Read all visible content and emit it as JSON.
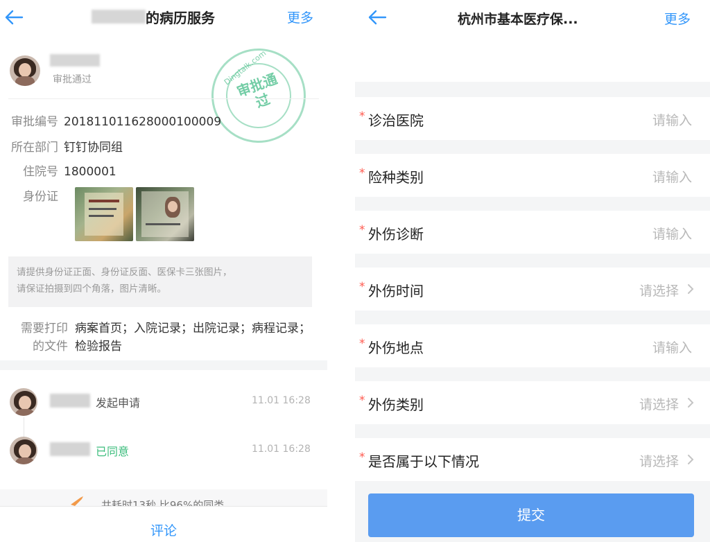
{
  "left": {
    "nav": {
      "title": "的病历服务",
      "more": "更多"
    },
    "applicant": {
      "status": "审批通过"
    },
    "stamp": {
      "site": "Dingtalk.com",
      "text": "审批通过"
    },
    "fields": [
      {
        "key": "审批编号",
        "value": "20181101162800010000 9"
      },
      {
        "key": "所在部门",
        "value": "钉钉协同组"
      },
      {
        "key": "住院号",
        "value": "1800001"
      },
      {
        "key": "身份证",
        "value": ""
      }
    ],
    "hint_line1": "请提供身份证正面、身份证反面、医保卡三张图片，",
    "hint_line2": "请保证拍摄到四个角落，图片清晰。",
    "print": {
      "key_line1": "需要打印",
      "key_line2": "的文件",
      "value": "病案首页；入院记录；出院记录；病程记录；检验报告"
    },
    "flow": [
      {
        "action": "发起申请",
        "time": "11.01 16:28",
        "color": "#555555"
      },
      {
        "action": "已同意",
        "time": "11.01 16:28",
        "color": "#3dbd7d"
      }
    ],
    "stat_text": "共耗时13秒,比96%的同类",
    "comment": "评论"
  },
  "right": {
    "nav": {
      "title": "杭州市基本医疗保...",
      "more": "更多"
    },
    "rows": [
      {
        "label": "诊治医院",
        "placeholder": "请输入",
        "select": false
      },
      {
        "label": "险种类别",
        "placeholder": "请输入",
        "select": false
      },
      {
        "label": "外伤诊断",
        "placeholder": "请输入",
        "select": false
      },
      {
        "label": "外伤时间",
        "placeholder": "请选择",
        "select": true
      },
      {
        "label": "外伤地点",
        "placeholder": "请输入",
        "select": false
      },
      {
        "label": "外伤类别",
        "placeholder": "请选择",
        "select": true
      },
      {
        "label": "是否属于以下情况",
        "placeholder": "请选择",
        "select": true
      }
    ],
    "required_mark": "*",
    "submit": "提交"
  },
  "colors": {
    "accent": "#3296fa",
    "approved": "#3dbd7d",
    "required": "#ff5a4f",
    "submit_bg": "#5a9cf0"
  }
}
